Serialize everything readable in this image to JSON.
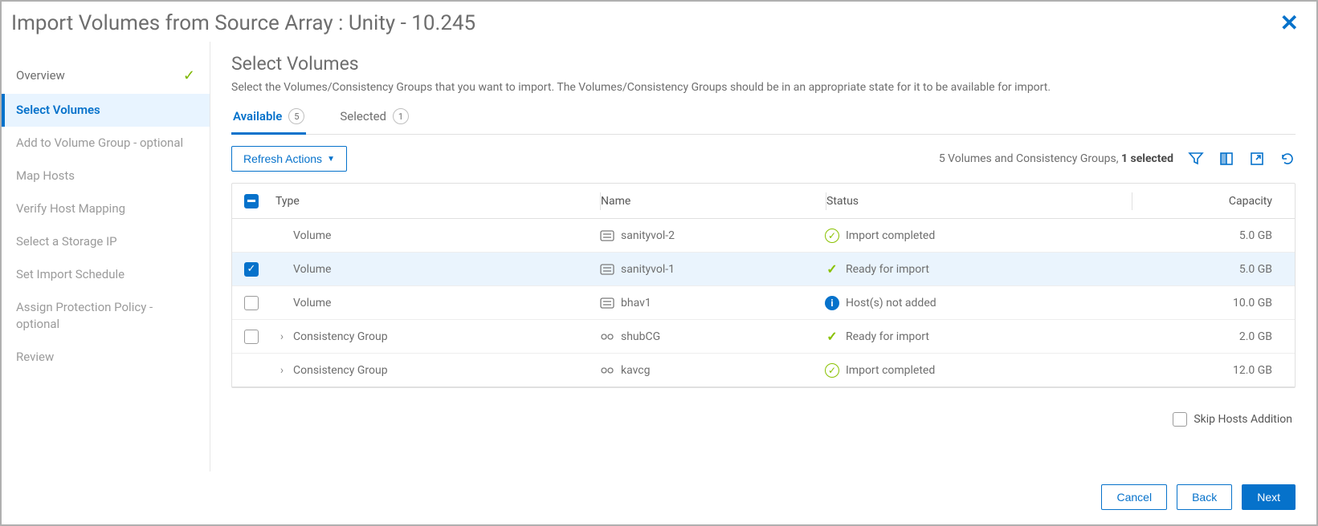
{
  "dialog": {
    "title": "Import Volumes from Source Array : Unity - 10.245"
  },
  "steps": {
    "overview": "Overview",
    "select_volumes": "Select Volumes",
    "add_volume_group": "Add to Volume Group - optional",
    "map_hosts": "Map Hosts",
    "verify_mapping": "Verify Host Mapping",
    "storage_ip": "Select a Storage IP",
    "schedule": "Set Import Schedule",
    "protection": "Assign Protection Policy - optional",
    "review": "Review"
  },
  "panel": {
    "heading": "Select Volumes",
    "description": "Select the Volumes/Consistency Groups that you want to import. The Volumes/Consistency Groups should be in an appropriate state for it to be available for import."
  },
  "tabs": {
    "available": {
      "label": "Available",
      "count": "5"
    },
    "selected": {
      "label": "Selected",
      "count": "1"
    }
  },
  "toolbar": {
    "refresh": "Refresh Actions",
    "summary_prefix": "5 Volumes and Consistency Groups, ",
    "summary_bold": "1 selected"
  },
  "columns": {
    "type": "Type",
    "name": "Name",
    "status": "Status",
    "capacity": "Capacity"
  },
  "rows": [
    {
      "checkbox": "none",
      "expand": "",
      "type": "Volume",
      "icon": "volume",
      "name": "sanityvol-2",
      "status_icon": "done",
      "status": "Import completed",
      "capacity": "5.0 GB",
      "selected": false
    },
    {
      "checkbox": "checked",
      "expand": "",
      "type": "Volume",
      "icon": "volume",
      "name": "sanityvol-1",
      "status_icon": "green",
      "status": "Ready for import",
      "capacity": "5.0 GB",
      "selected": true
    },
    {
      "checkbox": "unchecked",
      "expand": "",
      "type": "Volume",
      "icon": "volume",
      "name": "bhav1",
      "status_icon": "info",
      "status": "Host(s) not added",
      "capacity": "10.0 GB",
      "selected": false
    },
    {
      "checkbox": "unchecked",
      "expand": ">",
      "type": "Consistency Group",
      "icon": "cg",
      "name": "shubCG",
      "status_icon": "green",
      "status": "Ready for import",
      "capacity": "2.0 GB",
      "selected": false
    },
    {
      "checkbox": "none",
      "expand": ">",
      "type": "Consistency Group",
      "icon": "cg",
      "name": "kavcg",
      "status_icon": "done",
      "status": "Import completed",
      "capacity": "12.0 GB",
      "selected": false
    }
  ],
  "skip_hosts": "Skip Hosts Addition",
  "footer": {
    "cancel": "Cancel",
    "back": "Back",
    "next": "Next"
  }
}
